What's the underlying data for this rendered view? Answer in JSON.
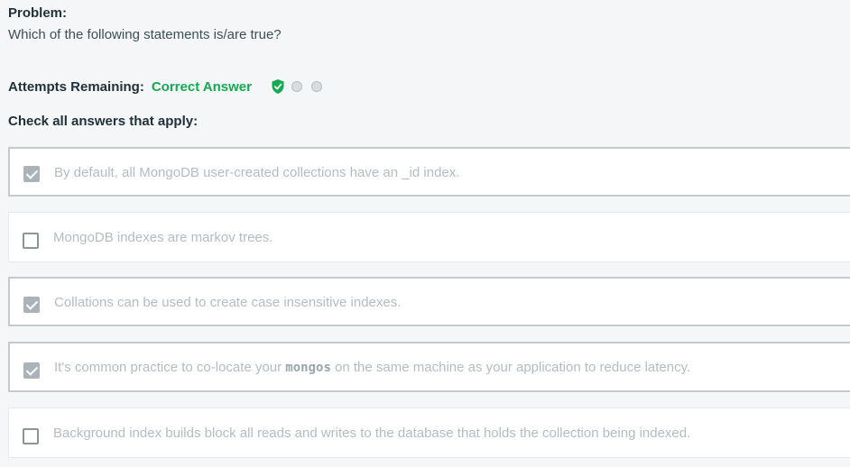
{
  "problem": {
    "label": "Problem:",
    "question": "Which of the following statements is/are true?"
  },
  "attempts": {
    "label": "Attempts Remaining:",
    "status": "Correct Answer",
    "status_color": "#13aa52",
    "indicators": [
      "shield-check-icon",
      "empty-dot",
      "empty-dot"
    ]
  },
  "instructions": "Check all answers that apply:",
  "options": [
    {
      "text": "By default, all MongoDB user-created collections have an _id index.",
      "checked": true
    },
    {
      "text": "MongoDB indexes are markov trees.",
      "checked": false
    },
    {
      "text": "Collations can be used to create case insensitive indexes.",
      "checked": true
    },
    {
      "text_before": "It's common practice to co-locate your ",
      "code": "mongos",
      "text_after": " on the same machine as your application to reduce latency.",
      "checked": true
    },
    {
      "text": "Background index builds block all reads and writes to the database that holds the collection being indexed.",
      "checked": false
    }
  ]
}
